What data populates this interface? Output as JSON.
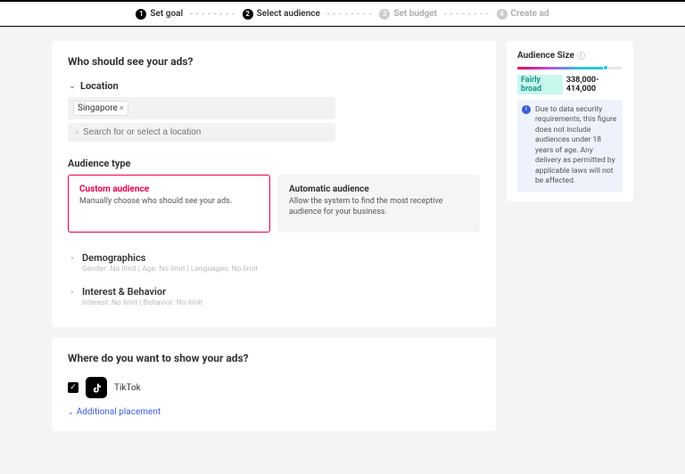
{
  "steps": {
    "s1": "Set goal",
    "s2": "Select audience",
    "s3": "Set budget",
    "s4": "Create ad"
  },
  "audience": {
    "title": "Who should see your ads?",
    "location_label": "Location",
    "location_chip": "Singapore",
    "search_placeholder": "Search for or select a location",
    "type_label": "Audience type",
    "custom": {
      "title": "Custom audience",
      "desc": "Manually choose who should see your ads."
    },
    "auto": {
      "title": "Automatic audience",
      "desc": "Allow the system to find the most receptive audience for your business."
    },
    "demographics": {
      "head": "Demographics",
      "sub": "Gender: No limit | Age: No limit | Languages: No limit"
    },
    "interest": {
      "head": "Interest & Behavior",
      "sub": "Interest: No limit | Behavior: No limit"
    }
  },
  "placement": {
    "title": "Where do you want to show your ads?",
    "tiktok": "TikTok",
    "addl": "Additional placement"
  },
  "side": {
    "title": "Audience Size",
    "badge": "Fairly broad",
    "range": "338,000-414,000",
    "notice": "Due to data security requirements, this figure does not include audiences under 18 years of age. Any delivery as permitted by applicable laws will not be affected."
  }
}
